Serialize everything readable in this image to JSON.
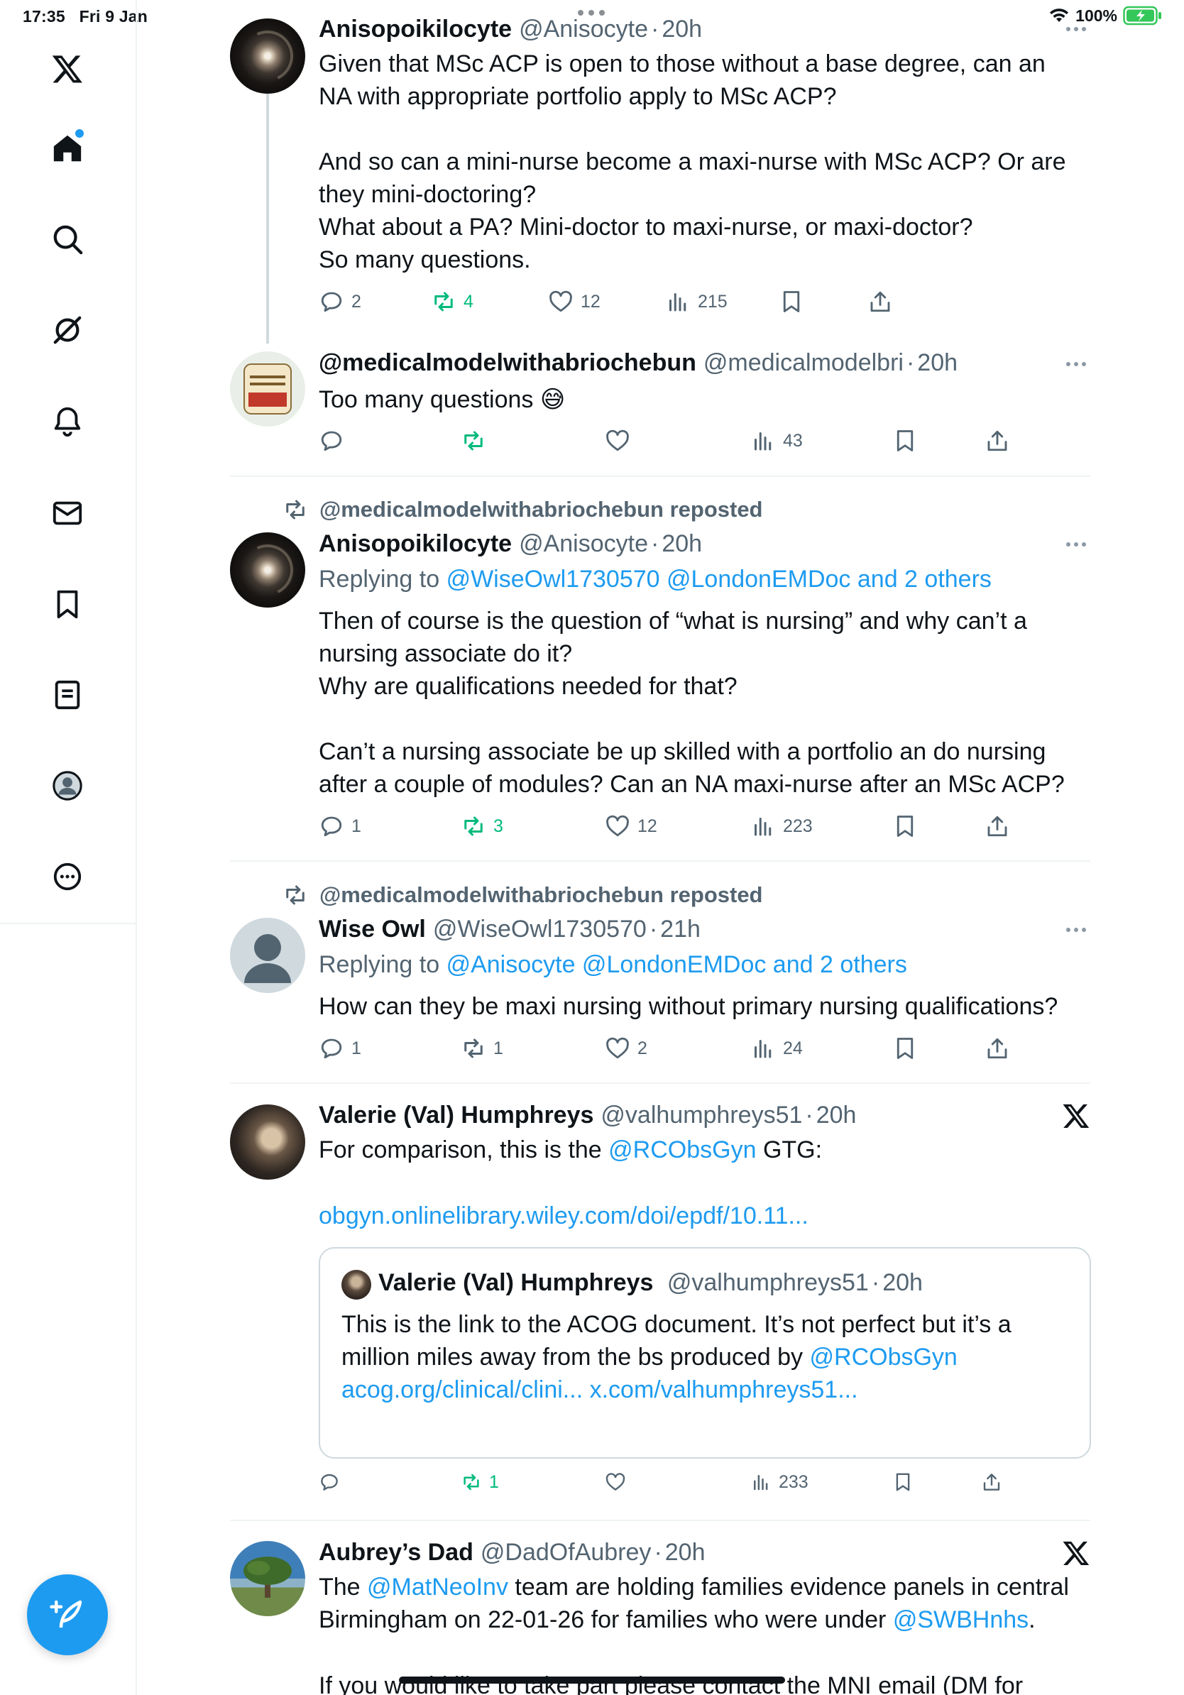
{
  "status_bar": {
    "time": "17:35",
    "date": "Fri 9 Jan",
    "battery": "100%"
  },
  "sidebar": {
    "items": [
      {
        "name": "x-logo-icon"
      },
      {
        "name": "home-icon"
      },
      {
        "name": "search-icon"
      },
      {
        "name": "grok-icon"
      },
      {
        "name": "notifications-icon"
      },
      {
        "name": "messages-icon"
      },
      {
        "name": "bookmarks-icon"
      },
      {
        "name": "lists-icon"
      },
      {
        "name": "profile-icon"
      },
      {
        "name": "more-icon"
      }
    ],
    "compose": "compose-icon"
  },
  "tweets": [
    {
      "name": "Anisopoikilocyte",
      "handle": "@Anisocyte",
      "time": "20h",
      "body": "Given that MSc ACP is open to those without a base degree, can an\nNA with appropriate portfolio apply to MSc ACP?\n\nAnd so can a mini-nurse become a maxi-nurse with MSc ACP? Or are\nthey mini-doctoring?\nWhat about a PA? Mini-doctor to maxi-nurse, or maxi-doctor?\nSo many questions.",
      "replies": "2",
      "reposts": "4",
      "likes": "12",
      "views": "215"
    },
    {
      "name": "@medicalmodelwithabriochebun",
      "handle": "@medicalmodelbri",
      "time": "20h",
      "body": "Too many questions 😅",
      "replies": "",
      "reposts": "",
      "likes": "",
      "views": "43"
    },
    {
      "repost_label": "@medicalmodelwithabriochebun reposted",
      "name": "Anisopoikilocyte",
      "handle": "@Anisocyte",
      "time": "20h",
      "replying_prefix": "Replying to",
      "replying_to": "@WiseOwl1730570 @LondonEMDoc and 2 others",
      "body": "Then of course is the question of “what is nursing” and why can’t a\nnursing associate do it?\nWhy are qualifications needed for that?\n\nCan’t a nursing associate be up skilled with a portfolio an do nursing\nafter a couple of modules? Can an NA maxi-nurse after an MSc ACP?",
      "replies": "1",
      "reposts": "3",
      "likes": "12",
      "views": "223"
    },
    {
      "repost_label": "@medicalmodelwithabriochebun reposted",
      "name": "Wise Owl",
      "handle": "@WiseOwl1730570",
      "time": "21h",
      "replying_prefix": "Replying to",
      "replying_to": "@Anisocyte @LondonEMDoc and 2 others",
      "body": "How can they be maxi nursing without primary nursing qualifications?",
      "replies": "1",
      "reposts": "1",
      "likes": "2",
      "views": "24"
    },
    {
      "name": "Valerie (Val) Humphreys",
      "handle": "@valhumphreys51",
      "time": "20h",
      "body_pre": "For comparison, this is the ",
      "body_mention": "@RCObsGyn",
      "body_post": " GTG:",
      "link": "obgyn.onlinelibrary.wiley.com/doi/epdf/10.11...",
      "quote": {
        "name": "Valerie (Val) Humphreys",
        "handle": "@valhumphreys51",
        "time": "20h",
        "body_pre": "This is the link to the ACOG document. It’s not perfect but it’s a\nmillion miles away from the bs produced by ",
        "body_mention": "@RCObsGyn",
        "link": "acog.org/clinical/clini... x.com/valhumphreys51..."
      },
      "replies": "",
      "reposts": "1",
      "likes": "",
      "views": "233"
    },
    {
      "name": "Aubrey’s Dad",
      "handle": "@DadOfAubrey",
      "time": "20h",
      "body_pre": "The ",
      "body_mention1": "@MatNeoInv",
      "body_mid": " team are holding families evidence panels in central\nBirmingham on 22-01-26 for families who were under ",
      "body_mention2": "@SWBHnhs",
      "body_post": ".",
      "body_cut": "If you would like to take part please contact the MNI email (DM for"
    }
  ],
  "colors": {
    "accent": "#1d9bf0",
    "repost_green": "#00ba7c",
    "muted": "#536471",
    "text": "#0f1419"
  }
}
